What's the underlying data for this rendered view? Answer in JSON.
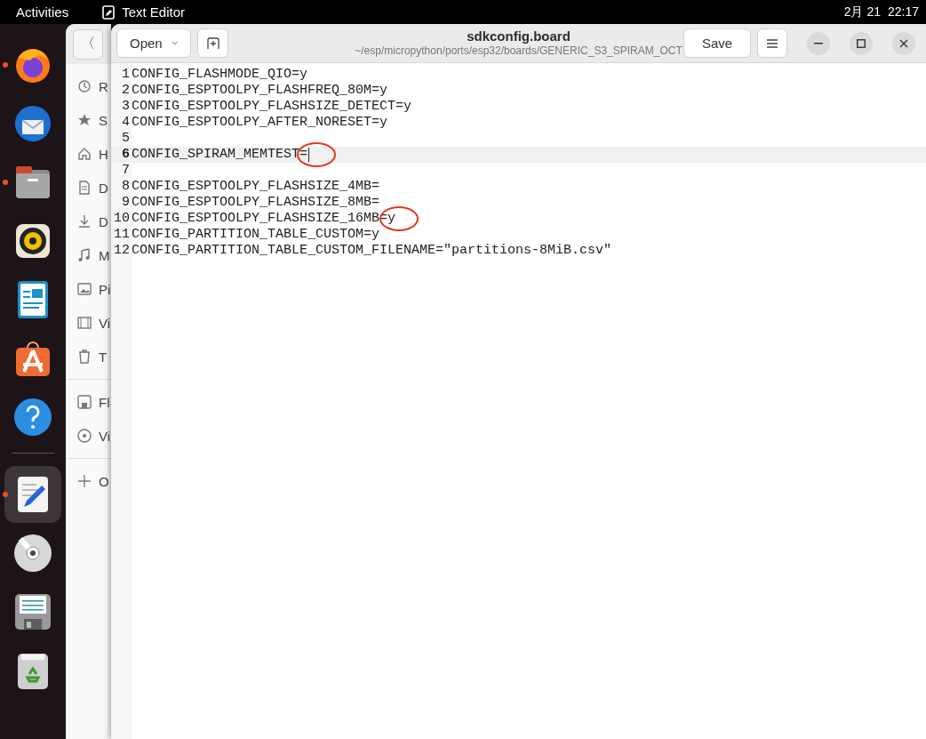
{
  "top_bar": {
    "activities": "Activities",
    "app_name": "Text Editor",
    "date": "2月 21",
    "time": "22:17"
  },
  "dock": [
    {
      "kind": "browser",
      "running": true,
      "selected": false
    },
    {
      "kind": "mail",
      "running": false,
      "selected": false
    },
    {
      "kind": "files",
      "running": true,
      "selected": false
    },
    {
      "kind": "music",
      "running": false,
      "selected": false
    },
    {
      "kind": "writer",
      "running": false,
      "selected": false
    },
    {
      "kind": "store",
      "running": false,
      "selected": false
    },
    {
      "kind": "help",
      "running": false,
      "selected": false
    },
    {
      "kind": "separator"
    },
    {
      "kind": "editor",
      "running": true,
      "selected": true
    },
    {
      "kind": "disc",
      "running": false,
      "selected": false
    },
    {
      "kind": "floppy",
      "running": false,
      "selected": false
    },
    {
      "kind": "trash",
      "running": false,
      "selected": false
    }
  ],
  "files_window": {
    "back_button": "〈",
    "sidebar": [
      {
        "kind": "recent",
        "label": "R"
      },
      {
        "kind": "starred",
        "label": "S"
      },
      {
        "kind": "home",
        "label": "H"
      },
      {
        "kind": "document",
        "label": "D"
      },
      {
        "kind": "download",
        "label": "D"
      },
      {
        "kind": "music",
        "label": "M"
      },
      {
        "kind": "picture",
        "label": "Pi"
      },
      {
        "kind": "video",
        "label": "Vi"
      },
      {
        "kind": "trash",
        "label": "T"
      },
      {
        "kind": "separator"
      },
      {
        "kind": "floppy",
        "label": "Fl"
      },
      {
        "kind": "disc",
        "label": "Vi"
      },
      {
        "kind": "separator"
      },
      {
        "kind": "add",
        "label": "O"
      }
    ]
  },
  "editor": {
    "open_button": "Open",
    "title": "sdkconfig.board",
    "path": "~/esp/micropython/ports/esp32/boards/GENERIC_S3_SPIRAM_OCT",
    "save_button": "Save",
    "lines": [
      {
        "number": "1",
        "text": "CONFIG_FLASHMODE_QIO=y",
        "current": false,
        "circled": false
      },
      {
        "number": "2",
        "text": "CONFIG_ESPTOOLPY_FLASHFREQ_80M=y",
        "current": false,
        "circled": false
      },
      {
        "number": "3",
        "text": "CONFIG_ESPTOOLPY_FLASHSIZE_DETECT=y",
        "current": false,
        "circled": false
      },
      {
        "number": "4",
        "text": "CONFIG_ESPTOOLPY_AFTER_NORESET=y",
        "current": false,
        "circled": false
      },
      {
        "number": "5",
        "current": false,
        "circled": false
      },
      {
        "number": "6",
        "text": "CONFIG_SPIRAM_MEMTEST=",
        "current": true,
        "circled": true
      },
      {
        "number": "7",
        "current": false,
        "circled": false
      },
      {
        "number": "8",
        "text": "CONFIG_ESPTOOLPY_FLASHSIZE_4MB=",
        "current": false,
        "circled": false
      },
      {
        "number": "9",
        "text": "CONFIG_ESPTOOLPY_FLASHSIZE_8MB=",
        "current": false,
        "circled": false
      },
      {
        "number": "10",
        "text": "CONFIG_ESPTOOLPY_FLASHSIZE_16MB=y",
        "current": false,
        "circled": true
      },
      {
        "number": "11",
        "text": "CONFIG_PARTITION_TABLE_CUSTOM=y",
        "current": false,
        "circled": false
      },
      {
        "number": "12",
        "text": "CONFIG_PARTITION_TABLE_CUSTOM_FILENAME=\"partitions-8MiB.csv\"",
        "current": false,
        "circled": false
      }
    ]
  }
}
